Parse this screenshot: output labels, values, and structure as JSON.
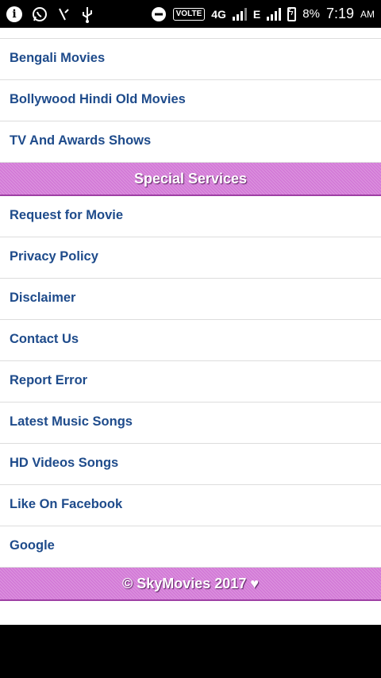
{
  "status_bar": {
    "icons": [
      "info-icon",
      "whatsapp-icon",
      "missed-call-icon",
      "usb-icon",
      "do-not-disturb-icon"
    ],
    "volte": "VOLTE",
    "network_1": "4G",
    "network_2": "E",
    "battery": "8%",
    "time": "7:19",
    "ampm": "AM"
  },
  "menu_top": [
    {
      "label": "Bengali Movies"
    },
    {
      "label": "Bollywood Hindi Old Movies"
    },
    {
      "label": "TV And Awards Shows"
    }
  ],
  "special_services": {
    "title": "Special Services",
    "items": [
      {
        "label": "Request for Movie"
      },
      {
        "label": "Privacy Policy"
      },
      {
        "label": "Disclaimer"
      },
      {
        "label": "Contact Us"
      },
      {
        "label": "Report Error"
      },
      {
        "label": "Latest Music Songs"
      },
      {
        "label": "HD Videos Songs"
      },
      {
        "label": "Like On Facebook"
      },
      {
        "label": "Google"
      }
    ]
  },
  "footer": {
    "text": "© SkyMovies 2017 ♥"
  },
  "colors": {
    "link": "#1e4b8b",
    "header_bg": "#d277d6",
    "divider": "#dddddd"
  }
}
